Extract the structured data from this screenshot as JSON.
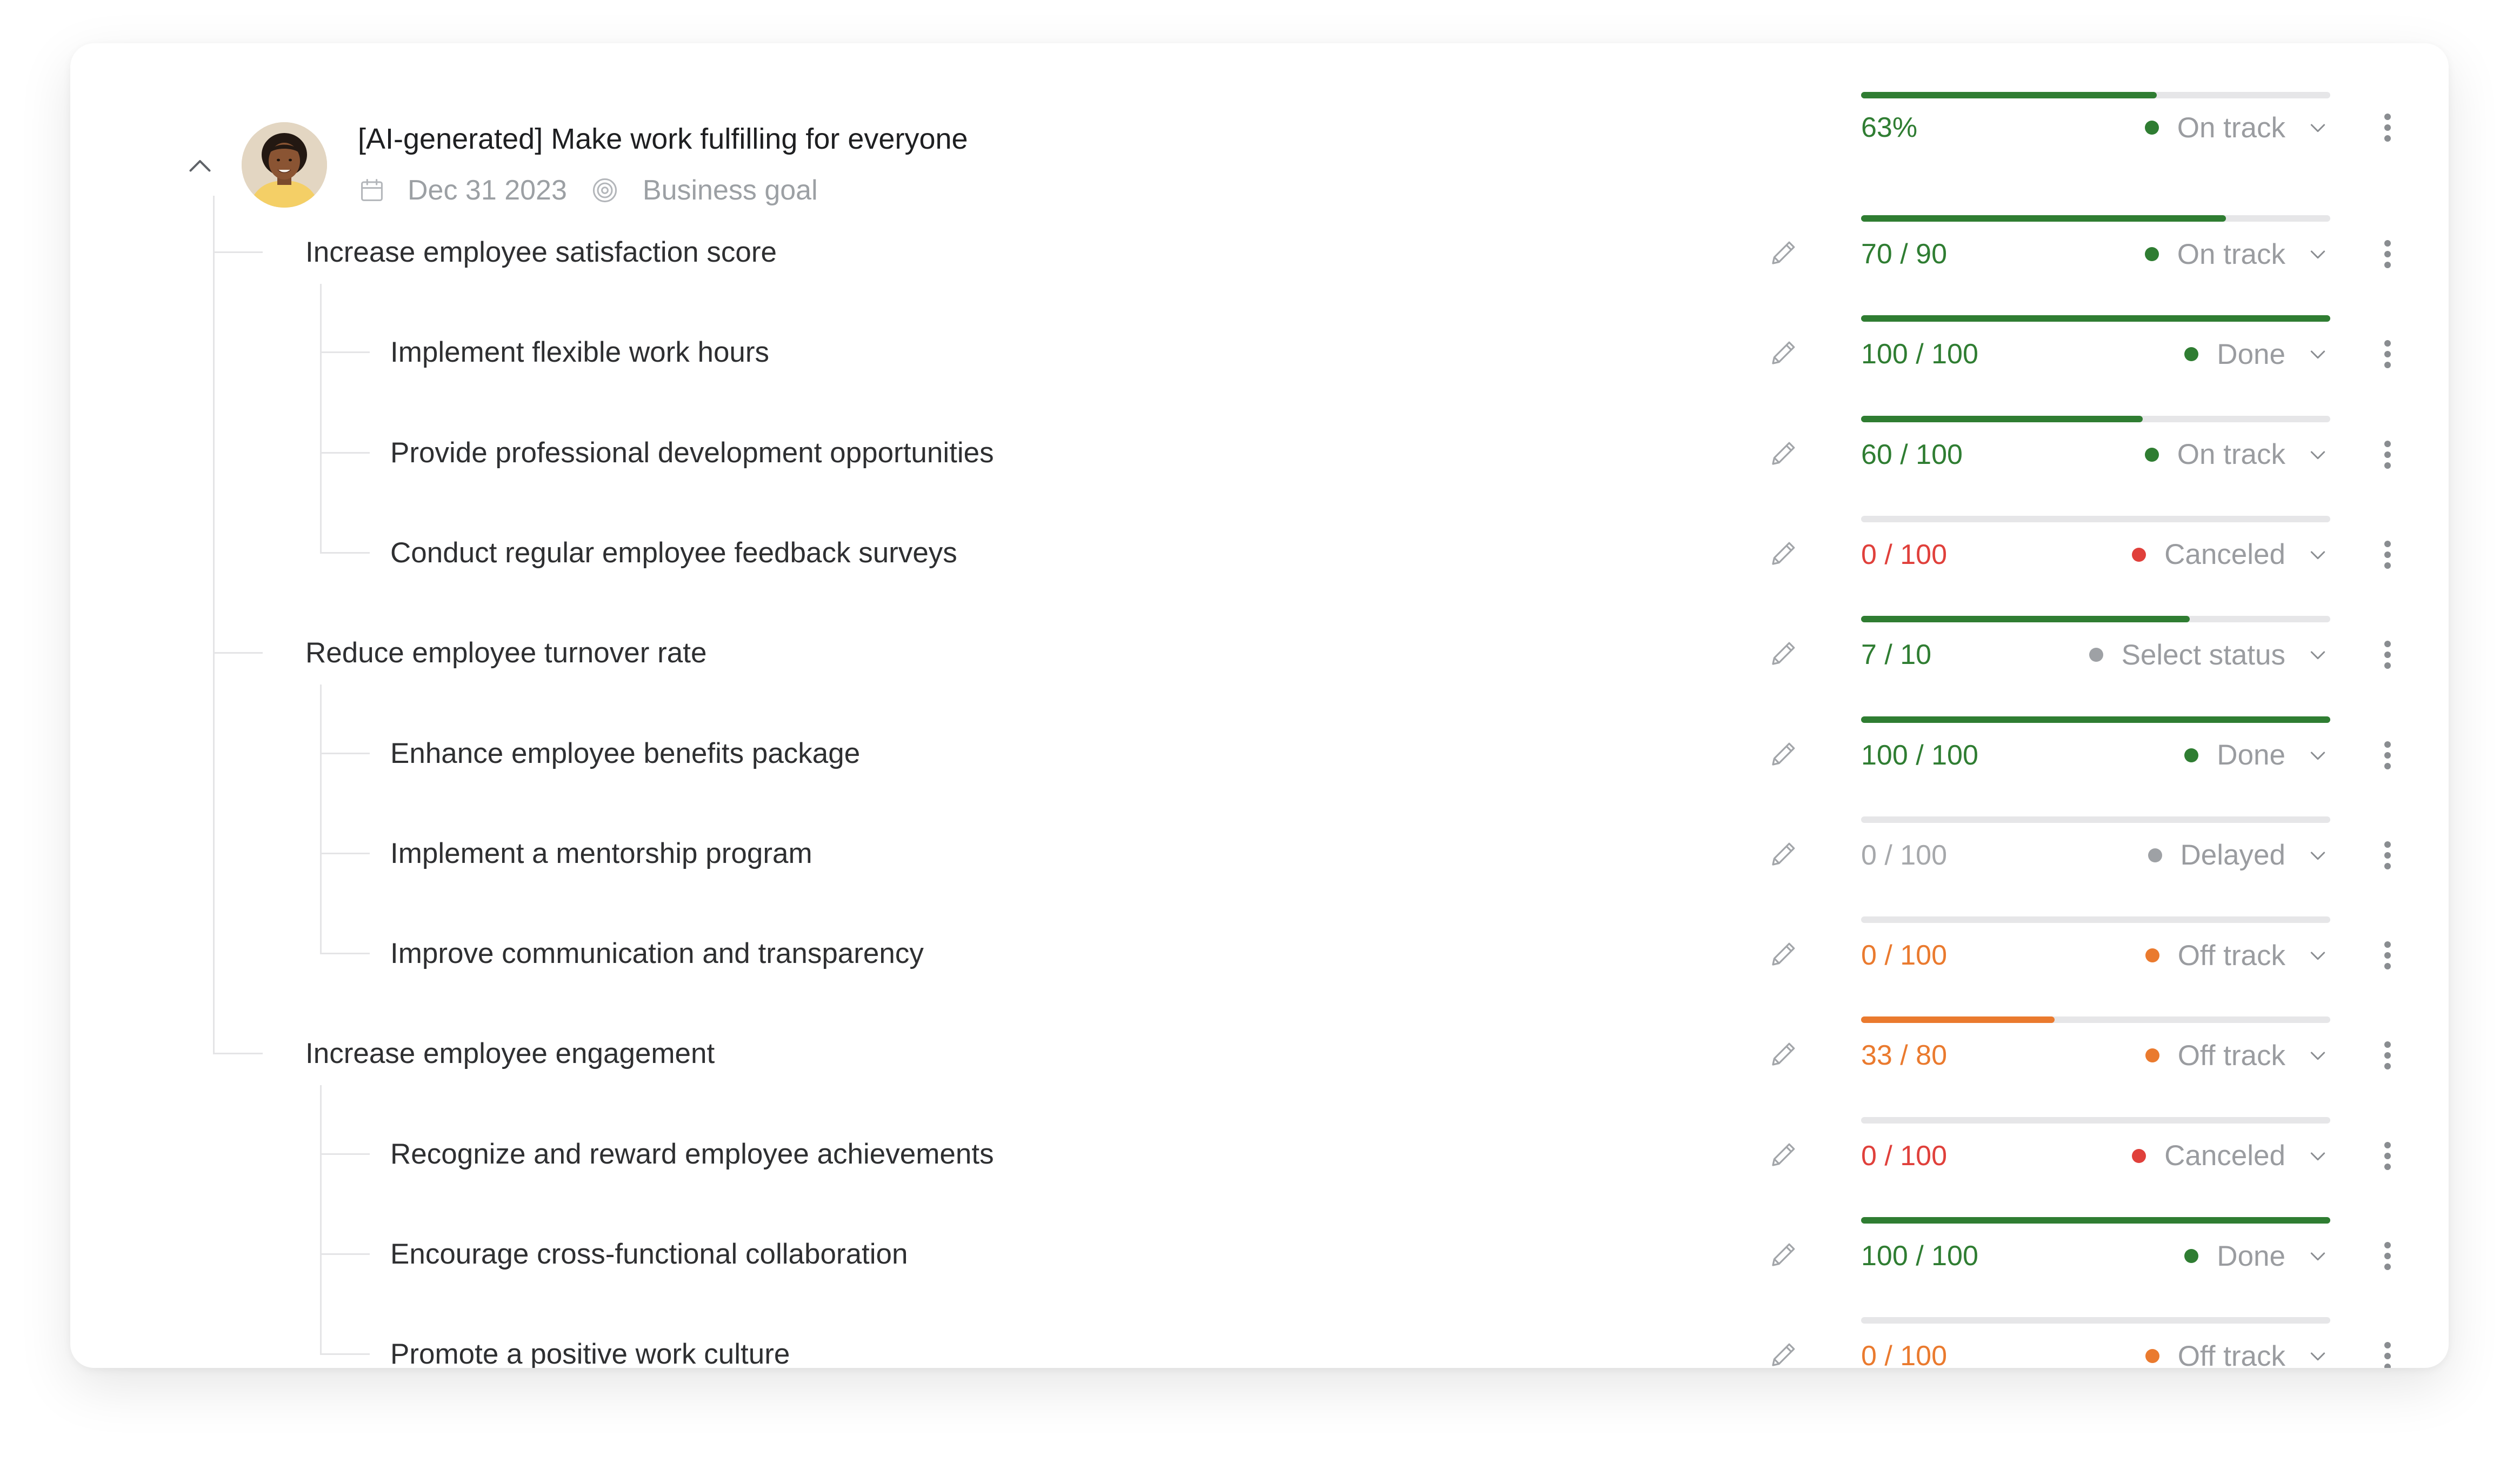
{
  "goal": {
    "title": "[AI-generated] Make work fulfilling for everyone",
    "date": "Dec 31 2023",
    "type": "Business goal",
    "progress_text": "63%",
    "progress_fraction": 0.63,
    "status": "On track"
  },
  "colors": {
    "green": "#2f7d32",
    "red": "#e0403b",
    "orange": "#ea7a2e",
    "gray_text": "#a6a8ab",
    "gray_dot": "#9ea1a5"
  },
  "rows": [
    {
      "label": "Increase employee satisfaction score",
      "value": "70 / 90",
      "progress": 0.778,
      "status": "On track",
      "tone": "green"
    },
    {
      "label": "Implement flexible work hours",
      "value": "100 / 100",
      "progress": 1.0,
      "status": "Done",
      "tone": "green"
    },
    {
      "label": "Provide professional development opportunities",
      "value": "60 / 100",
      "progress": 0.6,
      "status": "On track",
      "tone": "green"
    },
    {
      "label": "Conduct regular employee feedback surveys",
      "value": "0 / 100",
      "progress": 0,
      "status": "Canceled",
      "tone": "red"
    },
    {
      "label": "Reduce employee turnover rate",
      "value": "7 / 10",
      "progress": 0.7,
      "status": "Select status",
      "tone": "green_gray"
    },
    {
      "label": "Enhance employee benefits package",
      "value": "100 / 100",
      "progress": 1.0,
      "status": "Done",
      "tone": "green"
    },
    {
      "label": "Implement a mentorship program",
      "value": "0 / 100",
      "progress": 0,
      "status": "Delayed",
      "tone": "gray"
    },
    {
      "label": "Improve communication and transparency",
      "value": "0 / 100",
      "progress": 0,
      "status": "Off track",
      "tone": "orange"
    },
    {
      "label": "Increase employee engagement",
      "value": "33 / 80",
      "progress": 0.4125,
      "status": "Off track",
      "tone": "orange"
    },
    {
      "label": "Recognize and reward employee achievements",
      "value": "0 / 100",
      "progress": 0,
      "status": "Canceled",
      "tone": "red"
    },
    {
      "label": "Encourage cross-functional collaboration",
      "value": "100 / 100",
      "progress": 1.0,
      "status": "Done",
      "tone": "green"
    },
    {
      "label": "Promote a positive work culture",
      "value": "0 / 100",
      "progress": 0,
      "status": "Off track",
      "tone": "orange"
    }
  ],
  "icons": {
    "collapse": "chevron-up-icon",
    "date": "calendar-icon",
    "goal_type": "target-icon",
    "edit": "pencil-icon",
    "status_dropdown": "chevron-down-icon",
    "menu": "more-vertical-icon"
  }
}
